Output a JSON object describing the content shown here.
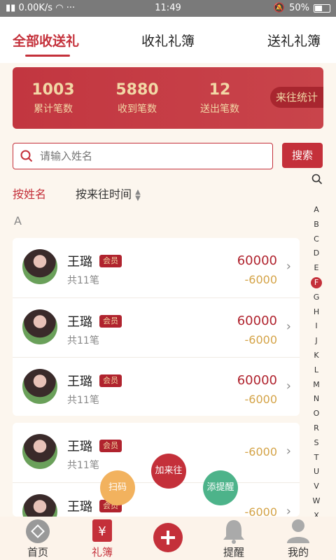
{
  "status": {
    "speed": "0.00K/s",
    "dots": "···",
    "time": "11:49",
    "battery": "50%"
  },
  "tabs": [
    "全部收送礼",
    "收礼礼簿",
    "送礼礼簿"
  ],
  "banner": {
    "stats": [
      {
        "value": "1003",
        "label": "累计笔数"
      },
      {
        "value": "5880",
        "label": "收到笔数"
      },
      {
        "value": "12",
        "label": "送出笔数"
      }
    ],
    "link": "来往统计"
  },
  "search": {
    "placeholder": "请输入姓名",
    "button": "搜索"
  },
  "sort": {
    "by_name": "按姓名",
    "by_time": "按来往时间"
  },
  "section": "A",
  "records": [
    {
      "name": "王璐",
      "badge": "会员",
      "count": "共11笔",
      "in": "60000",
      "out": "-6000"
    },
    {
      "name": "王璐",
      "badge": "会员",
      "count": "共11笔",
      "in": "60000",
      "out": "-6000"
    },
    {
      "name": "王璐",
      "badge": "会员",
      "count": "共11笔",
      "in": "60000",
      "out": "-6000"
    },
    {
      "name": "王璐",
      "badge": "会员",
      "count": "共11笔",
      "out": "-6000"
    },
    {
      "name": "王璐",
      "badge": "会员",
      "out": "-6000"
    }
  ],
  "alphabet": [
    "A",
    "B",
    "C",
    "D",
    "E",
    "F",
    "G",
    "H",
    "I",
    "J",
    "K",
    "L",
    "M",
    "N",
    "O",
    "R",
    "S",
    "T",
    "U",
    "V",
    "W",
    "X"
  ],
  "fabs": {
    "add": "加来往",
    "scan": "扫码",
    "remind": "添提醒"
  },
  "nav": [
    "首页",
    "礼簿",
    "",
    "提醒",
    "我的"
  ],
  "colors": {
    "accent": "#c4303a",
    "gold": "#d4a347",
    "scan": "#f2b25e",
    "remind": "#4db38a"
  }
}
